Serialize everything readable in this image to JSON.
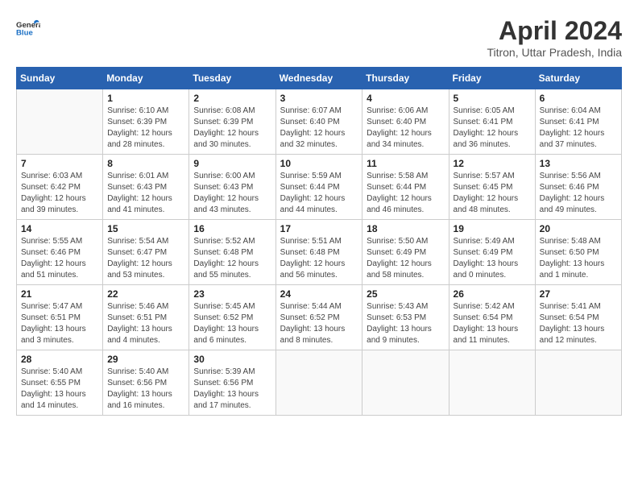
{
  "header": {
    "logo_general": "General",
    "logo_blue": "Blue",
    "title": "April 2024",
    "subtitle": "Titron, Uttar Pradesh, India"
  },
  "days_of_week": [
    "Sunday",
    "Monday",
    "Tuesday",
    "Wednesday",
    "Thursday",
    "Friday",
    "Saturday"
  ],
  "weeks": [
    [
      {
        "day": "",
        "info": ""
      },
      {
        "day": "1",
        "info": "Sunrise: 6:10 AM\nSunset: 6:39 PM\nDaylight: 12 hours\nand 28 minutes."
      },
      {
        "day": "2",
        "info": "Sunrise: 6:08 AM\nSunset: 6:39 PM\nDaylight: 12 hours\nand 30 minutes."
      },
      {
        "day": "3",
        "info": "Sunrise: 6:07 AM\nSunset: 6:40 PM\nDaylight: 12 hours\nand 32 minutes."
      },
      {
        "day": "4",
        "info": "Sunrise: 6:06 AM\nSunset: 6:40 PM\nDaylight: 12 hours\nand 34 minutes."
      },
      {
        "day": "5",
        "info": "Sunrise: 6:05 AM\nSunset: 6:41 PM\nDaylight: 12 hours\nand 36 minutes."
      },
      {
        "day": "6",
        "info": "Sunrise: 6:04 AM\nSunset: 6:41 PM\nDaylight: 12 hours\nand 37 minutes."
      }
    ],
    [
      {
        "day": "7",
        "info": "Sunrise: 6:03 AM\nSunset: 6:42 PM\nDaylight: 12 hours\nand 39 minutes."
      },
      {
        "day": "8",
        "info": "Sunrise: 6:01 AM\nSunset: 6:43 PM\nDaylight: 12 hours\nand 41 minutes."
      },
      {
        "day": "9",
        "info": "Sunrise: 6:00 AM\nSunset: 6:43 PM\nDaylight: 12 hours\nand 43 minutes."
      },
      {
        "day": "10",
        "info": "Sunrise: 5:59 AM\nSunset: 6:44 PM\nDaylight: 12 hours\nand 44 minutes."
      },
      {
        "day": "11",
        "info": "Sunrise: 5:58 AM\nSunset: 6:44 PM\nDaylight: 12 hours\nand 46 minutes."
      },
      {
        "day": "12",
        "info": "Sunrise: 5:57 AM\nSunset: 6:45 PM\nDaylight: 12 hours\nand 48 minutes."
      },
      {
        "day": "13",
        "info": "Sunrise: 5:56 AM\nSunset: 6:46 PM\nDaylight: 12 hours\nand 49 minutes."
      }
    ],
    [
      {
        "day": "14",
        "info": "Sunrise: 5:55 AM\nSunset: 6:46 PM\nDaylight: 12 hours\nand 51 minutes."
      },
      {
        "day": "15",
        "info": "Sunrise: 5:54 AM\nSunset: 6:47 PM\nDaylight: 12 hours\nand 53 minutes."
      },
      {
        "day": "16",
        "info": "Sunrise: 5:52 AM\nSunset: 6:48 PM\nDaylight: 12 hours\nand 55 minutes."
      },
      {
        "day": "17",
        "info": "Sunrise: 5:51 AM\nSunset: 6:48 PM\nDaylight: 12 hours\nand 56 minutes."
      },
      {
        "day": "18",
        "info": "Sunrise: 5:50 AM\nSunset: 6:49 PM\nDaylight: 12 hours\nand 58 minutes."
      },
      {
        "day": "19",
        "info": "Sunrise: 5:49 AM\nSunset: 6:49 PM\nDaylight: 13 hours\nand 0 minutes."
      },
      {
        "day": "20",
        "info": "Sunrise: 5:48 AM\nSunset: 6:50 PM\nDaylight: 13 hours\nand 1 minute."
      }
    ],
    [
      {
        "day": "21",
        "info": "Sunrise: 5:47 AM\nSunset: 6:51 PM\nDaylight: 13 hours\nand 3 minutes."
      },
      {
        "day": "22",
        "info": "Sunrise: 5:46 AM\nSunset: 6:51 PM\nDaylight: 13 hours\nand 4 minutes."
      },
      {
        "day": "23",
        "info": "Sunrise: 5:45 AM\nSunset: 6:52 PM\nDaylight: 13 hours\nand 6 minutes."
      },
      {
        "day": "24",
        "info": "Sunrise: 5:44 AM\nSunset: 6:52 PM\nDaylight: 13 hours\nand 8 minutes."
      },
      {
        "day": "25",
        "info": "Sunrise: 5:43 AM\nSunset: 6:53 PM\nDaylight: 13 hours\nand 9 minutes."
      },
      {
        "day": "26",
        "info": "Sunrise: 5:42 AM\nSunset: 6:54 PM\nDaylight: 13 hours\nand 11 minutes."
      },
      {
        "day": "27",
        "info": "Sunrise: 5:41 AM\nSunset: 6:54 PM\nDaylight: 13 hours\nand 12 minutes."
      }
    ],
    [
      {
        "day": "28",
        "info": "Sunrise: 5:40 AM\nSunset: 6:55 PM\nDaylight: 13 hours\nand 14 minutes."
      },
      {
        "day": "29",
        "info": "Sunrise: 5:40 AM\nSunset: 6:56 PM\nDaylight: 13 hours\nand 16 minutes."
      },
      {
        "day": "30",
        "info": "Sunrise: 5:39 AM\nSunset: 6:56 PM\nDaylight: 13 hours\nand 17 minutes."
      },
      {
        "day": "",
        "info": ""
      },
      {
        "day": "",
        "info": ""
      },
      {
        "day": "",
        "info": ""
      },
      {
        "day": "",
        "info": ""
      }
    ]
  ]
}
